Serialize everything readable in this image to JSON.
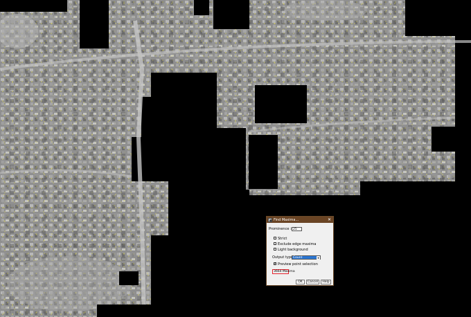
{
  "dialog": {
    "title": "Find Maxima...",
    "close_glyph": "✕",
    "prominence_label": "Prominence >",
    "prominence_value": "25",
    "options": [
      {
        "label": "Strict",
        "checked": false
      },
      {
        "label": "Exclude edge maxima",
        "checked": false
      },
      {
        "label": "Light background",
        "checked": false
      }
    ],
    "output_type_label": "Output type:",
    "output_type_value": "Count",
    "preview_label": "Preview point selection",
    "preview_checked": true,
    "result_text": "3664 Maxima",
    "buttons": {
      "ok": "OK",
      "cancel": "Cancel",
      "help": "Help"
    }
  },
  "colors": {
    "titlebar": "#6a4424",
    "highlight": "#e4202a",
    "select": "#2b76d2",
    "maxima_points": "#e8e060"
  },
  "icons": {
    "app": "imagej-app-icon",
    "close": "close-icon",
    "dropdown": "chevron-down-icon"
  }
}
